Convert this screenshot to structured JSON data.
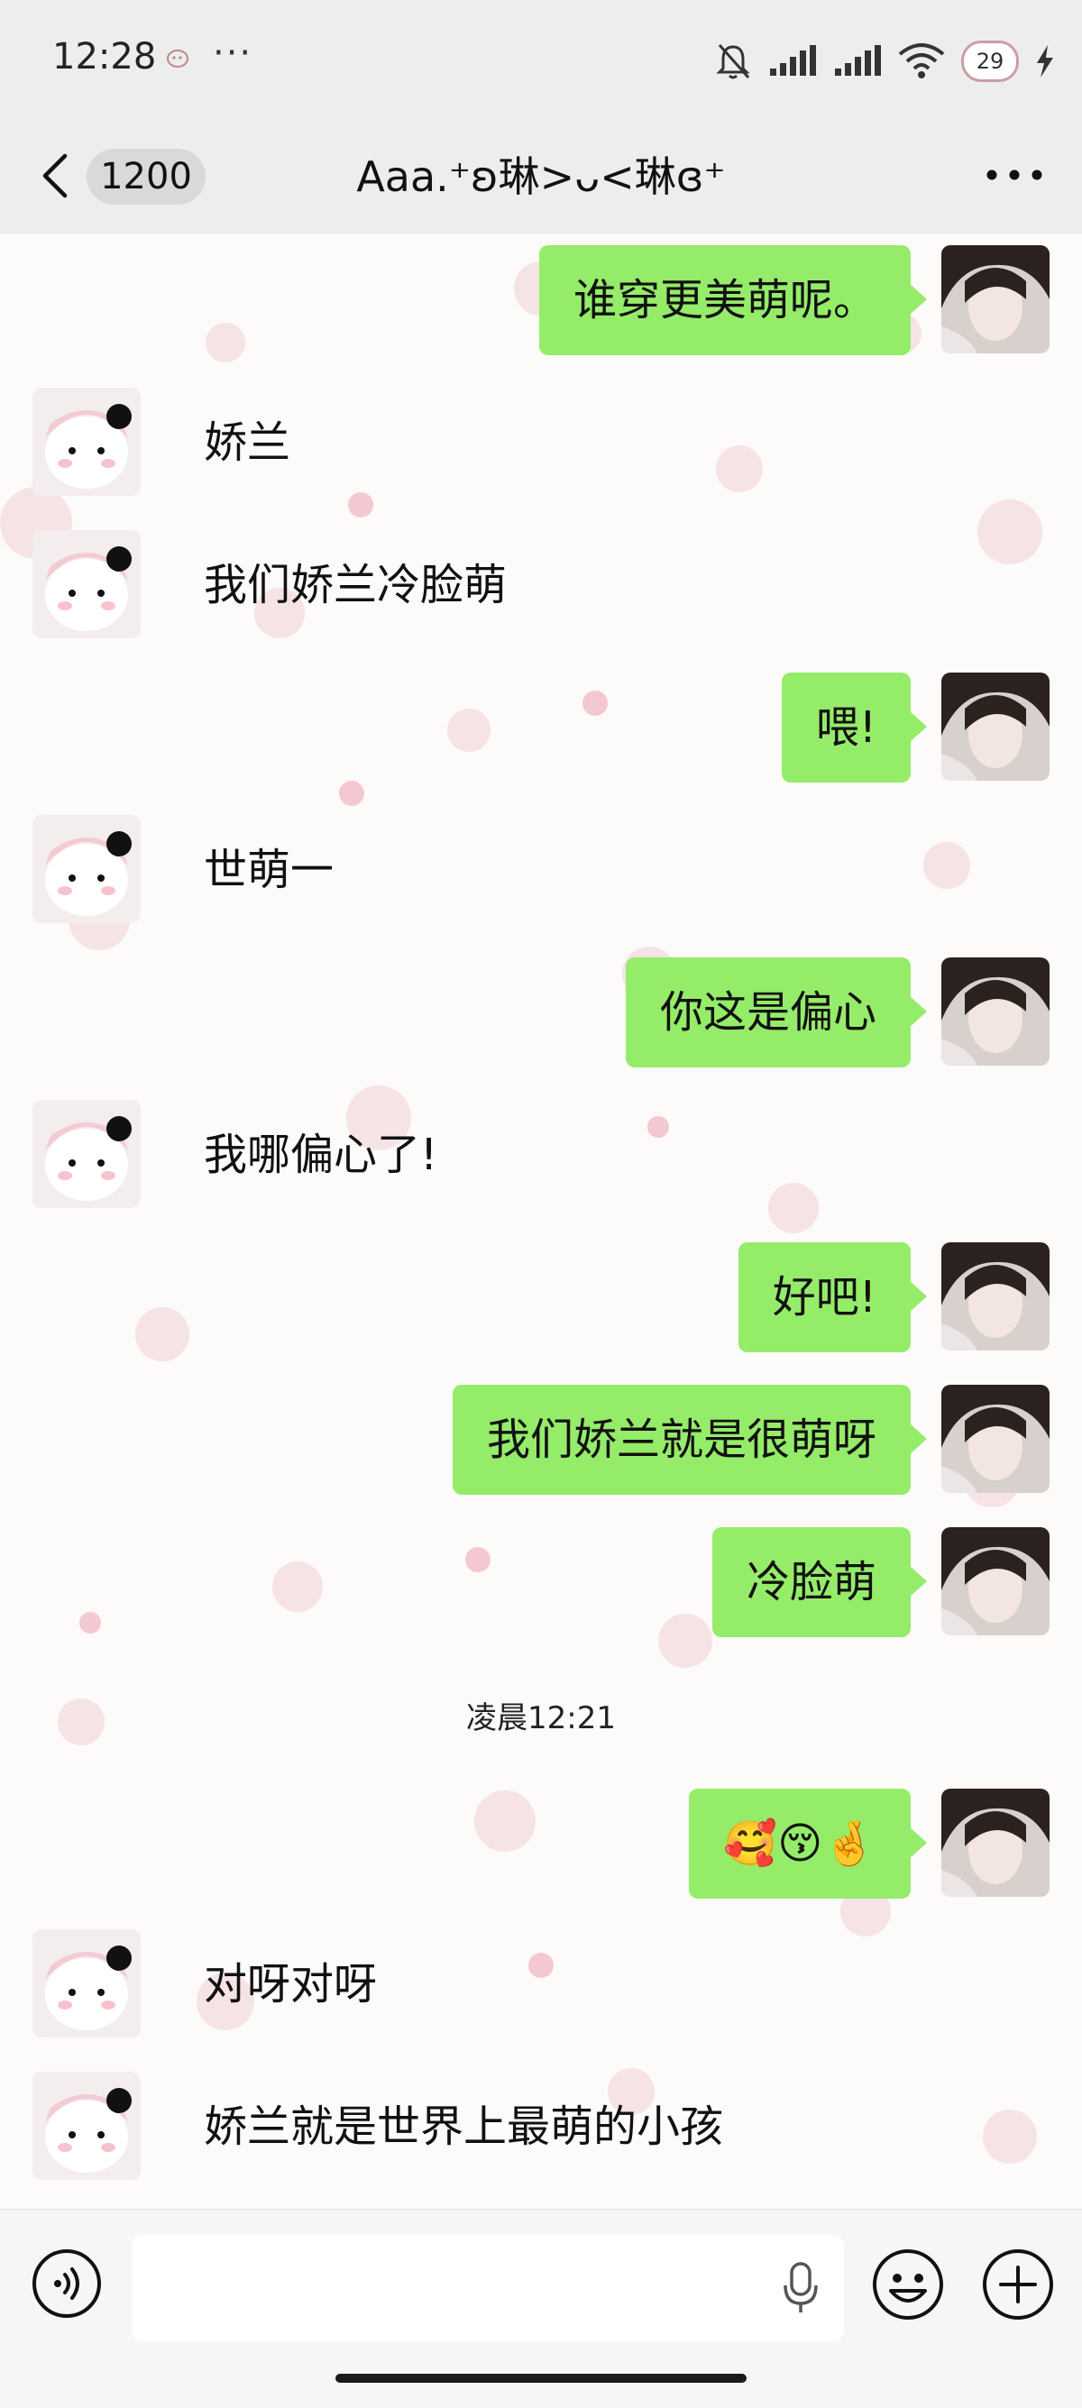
{
  "status_bar": {
    "time": "12:28",
    "dots": "···",
    "battery_level": "29",
    "icons": [
      "wechat-small-icon",
      "mute-bell-icon",
      "signal-icon",
      "signal-icon",
      "wifi-icon",
      "battery-icon",
      "charging-icon"
    ]
  },
  "nav": {
    "unread_count": "1200",
    "title": "Aaa.⁺ʚ琳>ᴗ<琳ɞ⁺",
    "icons": [
      "back-arrow-icon",
      "more-icon"
    ]
  },
  "messages": [
    {
      "side": "right",
      "text": "谁穿更美萌呢。"
    },
    {
      "side": "left",
      "text": "娇兰"
    },
    {
      "side": "left",
      "text": "我们娇兰冷脸萌"
    },
    {
      "side": "right",
      "text": "喂!"
    },
    {
      "side": "left",
      "text": "世萌一"
    },
    {
      "side": "right",
      "text": "你这是偏心"
    },
    {
      "side": "left",
      "text": "我哪偏心了!"
    },
    {
      "side": "right",
      "text": "好吧!"
    },
    {
      "side": "right",
      "text": "我们娇兰就是很萌呀"
    },
    {
      "side": "right",
      "text": "冷脸萌"
    },
    {
      "side": "right",
      "text": "🥰😚🤞"
    },
    {
      "side": "left",
      "text": "对呀对呀"
    },
    {
      "side": "left",
      "text": "娇兰就是世界上最萌的小孩"
    }
  ],
  "timestamp": "凌晨12:21",
  "colors": {
    "bubble_green": "#95ec69",
    "bar_gray": "#ededed",
    "input_bar": "#f6f6f6"
  },
  "bottom_bar": {
    "input_value": "",
    "icons": [
      "voice-icon",
      "mic-icon",
      "emoji-icon",
      "plus-icon"
    ]
  }
}
